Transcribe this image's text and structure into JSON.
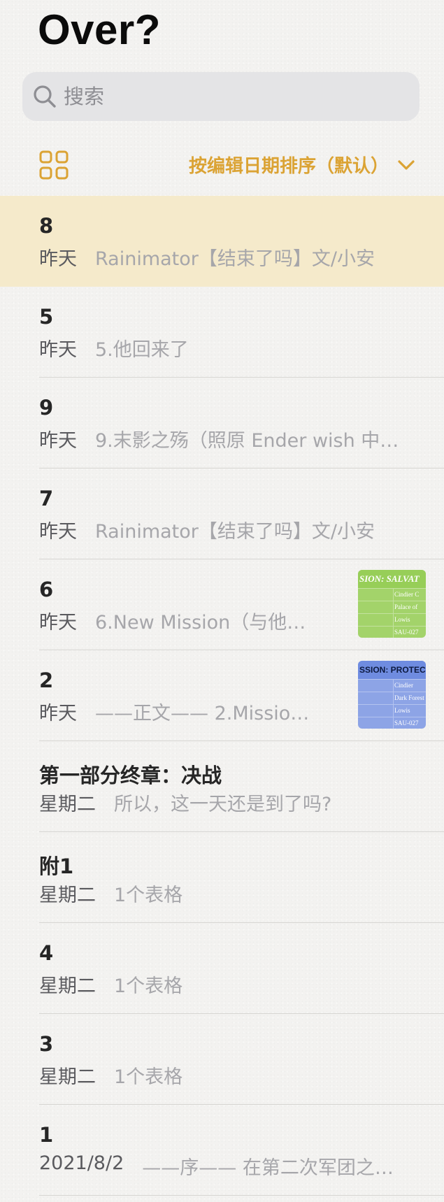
{
  "header": {
    "title": "Over?"
  },
  "search": {
    "placeholder": "搜索"
  },
  "toolbar": {
    "sort_label": "按编辑日期排序（默认）",
    "accent_color": "#dba334"
  },
  "notes": [
    {
      "title": "8",
      "date": "昨天",
      "preview": "Rainimator【结束了吗】文/小安",
      "selected": true
    },
    {
      "title": "5",
      "date": "昨天",
      "preview": "5.他回来了"
    },
    {
      "title": "9",
      "date": "昨天",
      "preview": "9.末影之殇（照原 Ender wish 中…"
    },
    {
      "title": "7",
      "date": "昨天",
      "preview": "Rainimator【结束了吗】文/小安"
    },
    {
      "title": "6",
      "date": "昨天",
      "preview": "6.New Mission（与他…",
      "thumbnail": {
        "color": "#a3d36a",
        "header": "SION: SALVAT",
        "rows": [
          "Cindier C",
          "Palace of",
          "Lowis",
          "SAU-027"
        ]
      }
    },
    {
      "title": "2",
      "date": "昨天",
      "preview": "——正文—— 2.Missio…",
      "thumbnail": {
        "color": "#8da4e6",
        "header": "SSION: PROTEC",
        "rows": [
          "Cindier",
          "Dark Forest",
          "Lowis",
          "SAU-027"
        ]
      }
    },
    {
      "title": "第一部分终章：决战",
      "date": "星期二",
      "preview": "所以，这一天还是到了吗?"
    },
    {
      "title": "附1",
      "date": "星期二",
      "preview": "1个表格"
    },
    {
      "title": "4",
      "date": "星期二",
      "preview": "1个表格"
    },
    {
      "title": "3",
      "date": "星期二",
      "preview": "1个表格"
    },
    {
      "title": "1",
      "date": "2021/8/2",
      "preview": "——序—— 在第二次军团之…"
    }
  ]
}
